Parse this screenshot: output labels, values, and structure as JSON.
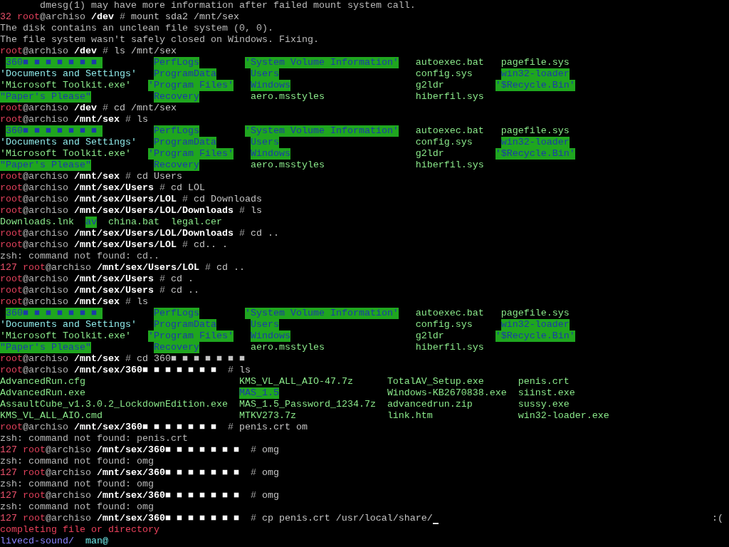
{
  "terminal": {
    "lines": [
      {
        "kind": "note",
        "text": "dmesg(1) may have more information after failed mount system call."
      },
      {
        "kind": "prompt",
        "status": "32",
        "user": "root",
        "host": "@archiso",
        "path": "/dev",
        "symbol": "#",
        "command": "mount sda2 /mnt/sex"
      },
      {
        "kind": "output",
        "text": "The disk contains an unclean file system (0, 0)."
      },
      {
        "kind": "output",
        "text": "The file system wasn't safely closed on Windows. Fixing."
      },
      {
        "kind": "prompt",
        "user": "root",
        "host": "@archiso",
        "path": "/dev",
        "symbol": "#",
        "command": "ls /mnt/sex"
      },
      {
        "kind": "listing",
        "columns": [
          [
            {
              "name": "360■ ■ ■ ■ ■ ■ ■ ",
              "kind": "dir"
            },
            {
              "name": "'Documents and Settings'",
              "kind": "quoted_symlink"
            },
            {
              "name": "'Microsoft Toolkit.exe'",
              "kind": "quoted_file"
            },
            {
              "name": "\"Paper's Please\"",
              "kind": "quoted_dir"
            }
          ],
          [
            {
              "name": "PerfLogs",
              "kind": "dir"
            },
            {
              "name": "ProgramData",
              "kind": "dir"
            },
            {
              "name": "'Program Files'",
              "kind": "quoted_dir"
            },
            {
              "name": "Recovery",
              "kind": "dir"
            }
          ],
          [
            {
              "name": "'System Volume Information'",
              "kind": "quoted_dir"
            },
            {
              "name": "Users",
              "kind": "dir"
            },
            {
              "name": "Windows",
              "kind": "dir"
            },
            {
              "name": "aero.msstyles",
              "kind": "file"
            }
          ],
          [
            {
              "name": "autoexec.bat",
              "kind": "file"
            },
            {
              "name": "config.sys",
              "kind": "file"
            },
            {
              "name": "g2ldr",
              "kind": "file"
            },
            {
              "name": "hiberfil.sys",
              "kind": "file"
            }
          ],
          [
            {
              "name": "pagefile.sys",
              "kind": "file"
            },
            {
              "name": "win32-loader",
              "kind": "dir"
            },
            {
              "name": "'$Recycle.Bin'",
              "kind": "quoted_dir"
            }
          ]
        ]
      },
      {
        "kind": "prompt",
        "user": "root",
        "host": "@archiso",
        "path": "/dev",
        "symbol": "#",
        "command": "cd /mnt/sex"
      },
      {
        "kind": "prompt",
        "user": "root",
        "host": "@archiso",
        "path": "/mnt/sex",
        "symbol": "#",
        "command": "ls"
      },
      {
        "kind": "listing",
        "columns": [
          [
            {
              "name": "360■ ■ ■ ■ ■ ■ ■ ",
              "kind": "dir"
            },
            {
              "name": "'Documents and Settings'",
              "kind": "quoted_symlink"
            },
            {
              "name": "'Microsoft Toolkit.exe'",
              "kind": "quoted_file"
            },
            {
              "name": "\"Paper's Please\"",
              "kind": "quoted_dir"
            }
          ],
          [
            {
              "name": "PerfLogs",
              "kind": "dir"
            },
            {
              "name": "ProgramData",
              "kind": "dir"
            },
            {
              "name": "'Program Files'",
              "kind": "quoted_dir"
            },
            {
              "name": "Recovery",
              "kind": "dir"
            }
          ],
          [
            {
              "name": "'System Volume Information'",
              "kind": "quoted_dir"
            },
            {
              "name": "Users",
              "kind": "dir"
            },
            {
              "name": "Windows",
              "kind": "dir"
            },
            {
              "name": "aero.msstyles",
              "kind": "file"
            }
          ],
          [
            {
              "name": "autoexec.bat",
              "kind": "file"
            },
            {
              "name": "config.sys",
              "kind": "file"
            },
            {
              "name": "g2ldr",
              "kind": "file"
            },
            {
              "name": "hiberfil.sys",
              "kind": "file"
            }
          ],
          [
            {
              "name": "pagefile.sys",
              "kind": "file"
            },
            {
              "name": "win32-loader",
              "kind": "dir"
            },
            {
              "name": "'$Recycle.Bin'",
              "kind": "quoted_dir"
            }
          ]
        ]
      },
      {
        "kind": "prompt",
        "user": "root",
        "host": "@archiso",
        "path": "/mnt/sex",
        "symbol": "#",
        "command": "cd Users"
      },
      {
        "kind": "prompt",
        "user": "root",
        "host": "@archiso",
        "path": "/mnt/sex/Users",
        "symbol": "#",
        "command": "cd LOL"
      },
      {
        "kind": "prompt",
        "user": "root",
        "host": "@archiso",
        "path": "/mnt/sex/Users/LOL",
        "symbol": "#",
        "command": "cd Downloads"
      },
      {
        "kind": "prompt",
        "user": "root",
        "host": "@archiso",
        "path": "/mnt/sex/Users/LOL/Downloads",
        "symbol": "#",
        "command": "ls"
      },
      {
        "kind": "listing",
        "columns": [
          [
            {
              "name": "Downloads.lnk",
              "kind": "file"
            }
          ],
          [
            {
              "name": "av",
              "kind": "dir"
            }
          ],
          [
            {
              "name": "china.bat",
              "kind": "file"
            }
          ],
          [
            {
              "name": "legal.cer",
              "kind": "file"
            }
          ]
        ]
      },
      {
        "kind": "prompt",
        "user": "root",
        "host": "@archiso",
        "path": "/mnt/sex/Users/LOL/Downloads",
        "symbol": "#",
        "command": "cd .."
      },
      {
        "kind": "prompt",
        "user": "root",
        "host": "@archiso",
        "path": "/mnt/sex/Users/LOL",
        "symbol": "#",
        "command": "cd.. ."
      },
      {
        "kind": "output",
        "text": "zsh: command not found: cd.."
      },
      {
        "kind": "prompt",
        "status": "127",
        "user": "root",
        "host": "@archiso",
        "path": "/mnt/sex/Users/LOL",
        "symbol": "#",
        "command": "cd .."
      },
      {
        "kind": "prompt",
        "user": "root",
        "host": "@archiso",
        "path": "/mnt/sex/Users",
        "symbol": "#",
        "command": "cd ."
      },
      {
        "kind": "prompt",
        "user": "root",
        "host": "@archiso",
        "path": "/mnt/sex/Users",
        "symbol": "#",
        "command": "cd .."
      },
      {
        "kind": "prompt",
        "user": "root",
        "host": "@archiso",
        "path": "/mnt/sex",
        "symbol": "#",
        "command": "ls"
      },
      {
        "kind": "listing",
        "columns": [
          [
            {
              "name": "360■ ■ ■ ■ ■ ■ ■ ",
              "kind": "dir"
            },
            {
              "name": "'Documents and Settings'",
              "kind": "quoted_symlink"
            },
            {
              "name": "'Microsoft Toolkit.exe'",
              "kind": "quoted_file"
            },
            {
              "name": "\"Paper's Please\"",
              "kind": "quoted_dir"
            }
          ],
          [
            {
              "name": "PerfLogs",
              "kind": "dir"
            },
            {
              "name": "ProgramData",
              "kind": "dir"
            },
            {
              "name": "'Program Files'",
              "kind": "quoted_dir"
            },
            {
              "name": "Recovery",
              "kind": "dir"
            }
          ],
          [
            {
              "name": "'System Volume Information'",
              "kind": "quoted_dir"
            },
            {
              "name": "Users",
              "kind": "dir"
            },
            {
              "name": "Windows",
              "kind": "dir"
            },
            {
              "name": "aero.msstyles",
              "kind": "file"
            }
          ],
          [
            {
              "name": "autoexec.bat",
              "kind": "file"
            },
            {
              "name": "config.sys",
              "kind": "file"
            },
            {
              "name": "g2ldr",
              "kind": "file"
            },
            {
              "name": "hiberfil.sys",
              "kind": "file"
            }
          ],
          [
            {
              "name": "pagefile.sys",
              "kind": "file"
            },
            {
              "name": "win32-loader",
              "kind": "dir"
            },
            {
              "name": "'$Recycle.Bin'",
              "kind": "quoted_dir"
            }
          ]
        ]
      },
      {
        "kind": "prompt",
        "user": "root",
        "host": "@archiso",
        "path": "/mnt/sex",
        "symbol": "#",
        "command": "cd 360■ ■ ■ ■ ■ ■ ■"
      },
      {
        "kind": "prompt",
        "user": "root",
        "host": "@archiso",
        "path": "/mnt/sex/360■ ■ ■ ■ ■ ■ ■ ",
        "symbol": "#",
        "command": "ls"
      },
      {
        "kind": "listing",
        "columns": [
          [
            {
              "name": "AdvancedRun.cfg",
              "kind": "file"
            },
            {
              "name": "AdvancedRun.exe",
              "kind": "file"
            },
            {
              "name": "AssaultCube_v1.3.0.2_LockdownEdition.exe",
              "kind": "file"
            },
            {
              "name": "KMS_VL_ALL_AIO.cmd",
              "kind": "file"
            }
          ],
          [
            {
              "name": "KMS_VL_ALL_AIO-47.7z",
              "kind": "file"
            },
            {
              "name": "MAS_1.5",
              "kind": "dir"
            },
            {
              "name": "MAS_1.5_Password_1234.7z",
              "kind": "file"
            },
            {
              "name": "MTKV273.7z",
              "kind": "file"
            }
          ],
          [
            {
              "name": "TotalAV_Setup.exe",
              "kind": "file"
            },
            {
              "name": "Windows-KB2670838.exe",
              "kind": "file"
            },
            {
              "name": "advancedrun.zip",
              "kind": "file"
            },
            {
              "name": "link.htm",
              "kind": "file"
            }
          ],
          [
            {
              "name": "penis.crt",
              "kind": "file"
            },
            {
              "name": "siinst.exe",
              "kind": "file"
            },
            {
              "name": "sussy.exe",
              "kind": "file"
            },
            {
              "name": "win32-loader.exe",
              "kind": "file"
            }
          ]
        ]
      },
      {
        "kind": "prompt",
        "user": "root",
        "host": "@archiso",
        "path": "/mnt/sex/360■ ■ ■ ■ ■ ■ ■ ",
        "symbol": "#",
        "command": "penis.crt om"
      },
      {
        "kind": "output",
        "text": "zsh: command not found: penis.crt"
      },
      {
        "kind": "prompt",
        "status": "127",
        "user": "root",
        "host": "@archiso",
        "path": "/mnt/sex/360■ ■ ■ ■ ■ ■ ■ ",
        "symbol": "#",
        "command": "omg"
      },
      {
        "kind": "output",
        "text": "zsh: command not found: omg"
      },
      {
        "kind": "prompt",
        "status": "127",
        "user": "root",
        "host": "@archiso",
        "path": "/mnt/sex/360■ ■ ■ ■ ■ ■ ■ ",
        "symbol": "#",
        "command": "omg"
      },
      {
        "kind": "output",
        "text": "zsh: command not found: omg"
      },
      {
        "kind": "prompt",
        "status": "127",
        "user": "root",
        "host": "@archiso",
        "path": "/mnt/sex/360■ ■ ■ ■ ■ ■ ■ ",
        "symbol": "#",
        "command": "omg"
      },
      {
        "kind": "output",
        "text": "zsh: command not found: omg"
      },
      {
        "kind": "prompt",
        "status": "127",
        "user": "root",
        "host": "@archiso",
        "path": "/mnt/sex/360■ ■ ■ ■ ■ ■ ■ ",
        "symbol": "#",
        "command": "cp penis.crt /usr/local/share/",
        "cursor": true,
        "right_prompt": ":("
      },
      {
        "kind": "message",
        "text": "completing file or directory"
      },
      {
        "kind": "completion",
        "items": [
          {
            "name": "livecd-sound/",
            "kind": "dir"
          },
          {
            "name": "man@",
            "kind": "symlink"
          }
        ]
      }
    ]
  }
}
